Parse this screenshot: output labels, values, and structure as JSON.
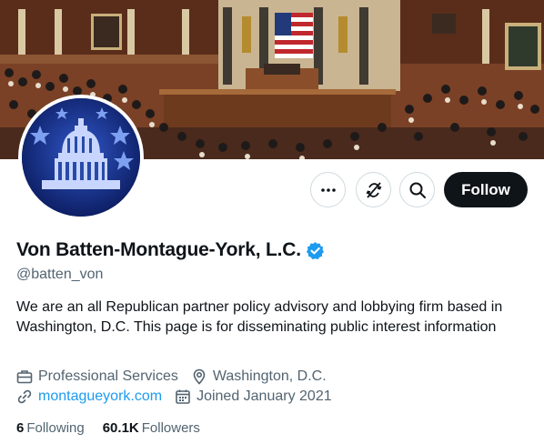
{
  "profile": {
    "display_name": "Von Batten-Montague-York, L.C.",
    "handle": "@batten_von",
    "bio": "We are an all Republican partner policy advisory and lobbying firm based in Washington, D.C. This page is for disseminating public interest information",
    "category": "Professional Services",
    "location": "Washington, D.C.",
    "website": "montagueyork.com",
    "joined": "Joined January 2021"
  },
  "actions": {
    "follow_label": "Follow",
    "more_icon": "more-horizontal-icon",
    "subscribe_icon": "subscribe-off-icon",
    "search_icon": "search-icon"
  },
  "stats": {
    "following_count": "6",
    "following_label": "Following",
    "followers_count": "60.1K",
    "followers_label": "Followers"
  },
  "colors": {
    "accent": "#1d9bf0",
    "text": "#0f1419",
    "secondary_text": "#536471",
    "avatar_bg": "#0d1f66",
    "follow_bg": "#0f1419"
  }
}
